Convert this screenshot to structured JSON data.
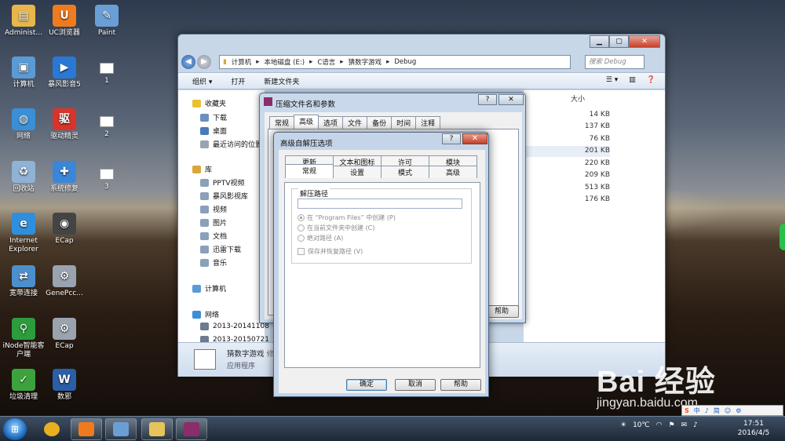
{
  "desktop": {
    "icons": [
      {
        "label": "Administ...",
        "icon": "user-folder-icon",
        "color": "#e8b64a"
      },
      {
        "label": "UC浏览器",
        "icon": "uc-browser-icon",
        "color": "#f07b1e"
      },
      {
        "label": "Paint",
        "icon": "paint-icon",
        "color": "#6a9fd6"
      },
      {
        "label": "计算机",
        "icon": "computer-icon",
        "color": "#5b9bd5"
      },
      {
        "label": "暴风影音5",
        "icon": "baofeng-icon",
        "color": "#2a78d6"
      },
      {
        "label": "1",
        "icon": "screenshot-icon",
        "color": "#ffffff"
      },
      {
        "label": "网络",
        "icon": "network-icon",
        "color": "#3a8fd6"
      },
      {
        "label": "驱动精灵",
        "icon": "driver-genius-icon",
        "color": "#d9342b"
      },
      {
        "label": "2",
        "icon": "screenshot-icon",
        "color": "#ffffff"
      },
      {
        "label": "回收站",
        "icon": "recycle-bin-icon",
        "color": "#8fb2d6"
      },
      {
        "label": "系统修复",
        "icon": "system-repair-icon",
        "color": "#3b86d9"
      },
      {
        "label": "3",
        "icon": "screenshot-icon",
        "color": "#ffffff"
      },
      {
        "label": "Internet Explorer",
        "icon": "ie-icon",
        "color": "#2f8fdd"
      },
      {
        "label": "ECap",
        "icon": "camera-icon",
        "color": "#444444"
      },
      {
        "label": "宽带连接",
        "icon": "broadband-icon",
        "color": "#4d8fcc"
      },
      {
        "label": "GenePcc...",
        "icon": "gear-doc-icon",
        "color": "#9aa4b0"
      },
      {
        "label": "iNode智能客户端",
        "icon": "inode-icon",
        "color": "#2c9c3c"
      },
      {
        "label": "ECap",
        "icon": "gear-doc-icon",
        "color": "#9aa4b0"
      },
      {
        "label": "垃圾清理",
        "icon": "cleanup-icon",
        "color": "#3ca33c"
      },
      {
        "label": "数邪",
        "icon": "word-doc-icon",
        "color": "#2b5ea8"
      }
    ]
  },
  "explorer": {
    "address": [
      "计算机",
      "本地磁盘 (E:)",
      "C语言",
      "猜数字游戏",
      "Debug"
    ],
    "search_placeholder": "搜索 Debug",
    "toolbar": {
      "organize": "组织 ▾",
      "open": "打开",
      "new_folder": "新建文件夹"
    },
    "nav": {
      "favorites": "收藏夹",
      "fav_items": [
        "下载",
        "桌面",
        "最近访问的位置"
      ],
      "library": "库",
      "lib_items": [
        "PPTV视频",
        "暴风影视库",
        "视频",
        "图片",
        "文档",
        "迅雷下载",
        "音乐"
      ],
      "computer": "计算机",
      "network": "网络",
      "net_items": [
        "2013-20141108",
        "2013-20150721"
      ]
    },
    "size_header": "大小",
    "sizes": [
      "14 KB",
      "137 KB",
      "76 KB",
      "201 KB",
      "220 KB",
      "209 KB",
      "513 KB",
      "176 KB"
    ],
    "details": {
      "name": "猜数字游戏",
      "modified_prefix": "修",
      "type": "应用程序"
    }
  },
  "dialog_archive": {
    "title": "压缩文件名和参数",
    "help_q": "?",
    "close": "✕",
    "tabs": [
      "常规",
      "高级",
      "选项",
      "文件",
      "备份",
      "时间",
      "注释"
    ],
    "active_tab": "高级",
    "help_button": "帮助"
  },
  "dialog_sfx": {
    "title": "高级自解压选项",
    "help_q": "?",
    "close": "✕",
    "tabs_row1": [
      "更新",
      "文本和图标",
      "许可",
      "模块"
    ],
    "tabs_row2": [
      "常规",
      "设置",
      "模式",
      "高级"
    ],
    "active_tab": "常规",
    "group_label": "解压路径",
    "path_value": "",
    "options": [
      "在 “Program Files” 中创建 (P)",
      "在当前文件夹中创建 (C)",
      "绝对路径 (A)"
    ],
    "selected_option": 0,
    "save_restore": "保存并恢复路径 (V)",
    "buttons": {
      "ok": "确定",
      "cancel": "取消",
      "help": "帮助"
    }
  },
  "taskbar": {
    "apps": [
      {
        "icon": "qq-icon",
        "color": "#e8b020"
      },
      {
        "icon": "uc-browser-icon",
        "color": "#f07b1e"
      },
      {
        "icon": "paint-icon",
        "color": "#6a9fd6"
      },
      {
        "icon": "explorer-icon",
        "color": "#e7c45b"
      },
      {
        "icon": "winrar-icon",
        "color": "#8b2d6b"
      }
    ],
    "weather": "10℃",
    "time": "17:51",
    "date": "2016/4/5"
  },
  "watermark": {
    "main": "Bai 经验",
    "sub": "jingyan.baidu.com"
  },
  "ime": {
    "logo": "S",
    "items": [
      "中",
      "♪",
      "简",
      "☺",
      "⚙"
    ]
  }
}
